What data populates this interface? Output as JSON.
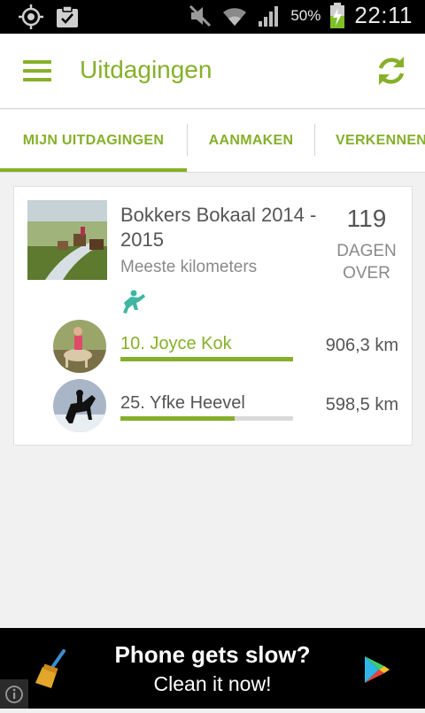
{
  "status_bar": {
    "battery_percent": "50%",
    "time": "22:11",
    "icons": [
      "gps-icon",
      "clipboard-check-icon",
      "mute-icon",
      "wifi-icon",
      "signal-icon",
      "battery-charging-icon"
    ]
  },
  "app_bar": {
    "title": "Uitdagingen",
    "menu_icon": "hamburger-menu-icon",
    "refresh_icon": "refresh-icon",
    "accent_color": "#86b02a"
  },
  "tabs": [
    {
      "label": "MIJN UITDAGINGEN",
      "selected": true
    },
    {
      "label": "AANMAKEN",
      "selected": false
    },
    {
      "label": "VERKENNEN",
      "selected": false
    }
  ],
  "challenge": {
    "title": "Bokkers Bokaal 2014 - 2015",
    "subtitle": "Meeste kilometers",
    "days_remaining": "119",
    "days_label": "DAGEN OVER",
    "activity_icon": "horse-rider-icon",
    "entries": [
      {
        "rank_name": "10.  Joyce Kok",
        "distance": "906,3 km",
        "progress": 1.0,
        "highlight": true
      },
      {
        "rank_name": "25.  Yfke Heevel",
        "distance": "598,5 km",
        "progress": 0.66,
        "highlight": false
      }
    ]
  },
  "ad": {
    "line1": "Phone gets slow?",
    "line2": "Clean it now!",
    "icons": [
      "broom-icon",
      "play-store-icon",
      "info-icon"
    ]
  }
}
